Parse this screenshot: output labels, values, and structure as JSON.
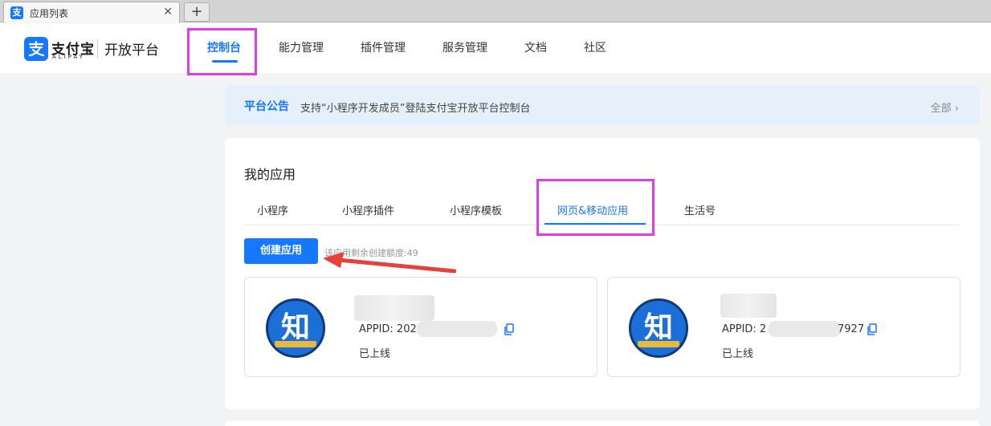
{
  "browser": {
    "tab_title": "应用列表",
    "tab_close": "✕",
    "new_tab": "+",
    "favicon_char": "支"
  },
  "header": {
    "logo_cn": "支付宝",
    "logo_en": "ALIPAY",
    "platform": "开放平台",
    "nav": [
      "控制台",
      "能力管理",
      "插件管理",
      "服务管理",
      "文档",
      "社区"
    ]
  },
  "notice": {
    "title": "平台公告",
    "text": "支持“小程序开发成员”登陆支付宝开放平台控制台",
    "all": "全部 ›"
  },
  "apps_section": {
    "title": "我的应用",
    "tabs": [
      "小程序",
      "小程序插件",
      "小程序模板",
      "网页&移动应用",
      "生活号"
    ],
    "create_button": "创建应用",
    "quota_text": "该应用剩余创建额度:49",
    "apps": [
      {
        "icon_glyph": "知",
        "appid_label": "APPID: 202",
        "appid_suffix": "",
        "status": "已上线"
      },
      {
        "icon_glyph": "知",
        "appid_label": "APPID: 2",
        "appid_suffix": "7927",
        "status": "已上线"
      }
    ]
  },
  "colors": {
    "accent": "#1677ff",
    "highlight": "#e23ce6",
    "arrow": "#e8403a"
  }
}
